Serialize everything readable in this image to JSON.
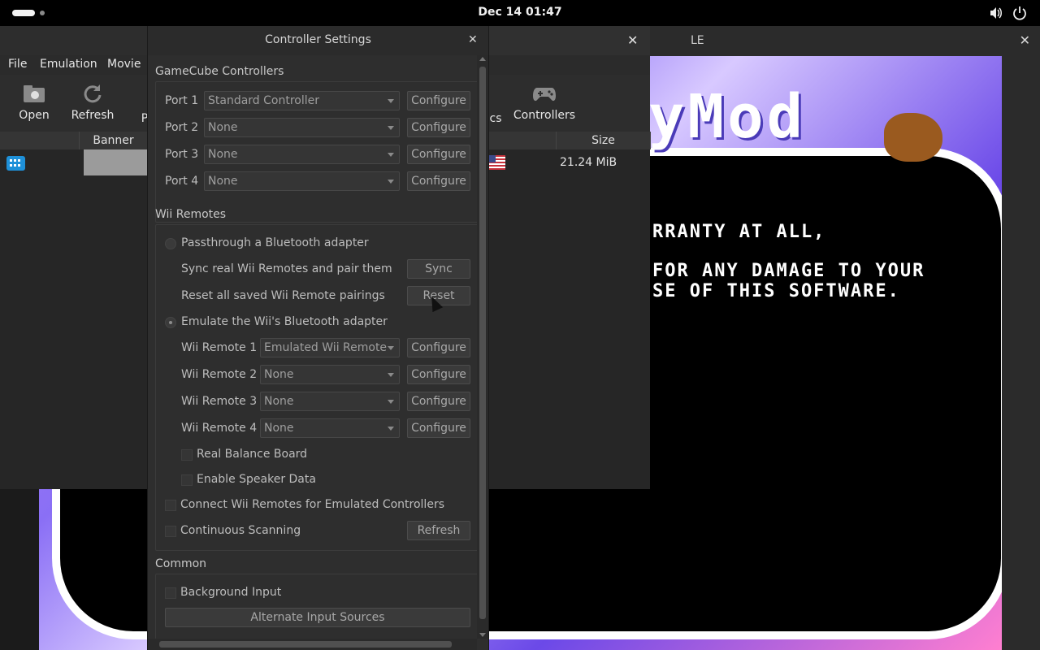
{
  "topbar": {
    "clock": "Dec 14  01:47",
    "icons": [
      "volume-icon",
      "power-icon"
    ]
  },
  "game_window": {
    "title_partial": "LE",
    "screen_text": [
      "yMod",
      "RRANTY AT ALL,",
      "FOR ANY DAMAGE TO YOUR",
      "SE OF THIS SOFTWARE."
    ]
  },
  "main_window": {
    "menu": [
      "File",
      "Emulation",
      "Movie"
    ],
    "toolbar": {
      "open": "Open",
      "refresh": "Refresh",
      "partial_left": "P",
      "partial_right": "cs",
      "controllers": "Controllers"
    },
    "columns": {
      "banner": "Banner",
      "size": "Size"
    },
    "row": {
      "size": "21.24 MiB"
    }
  },
  "dialog": {
    "title": "Controller Settings",
    "gamecube": {
      "heading": "GameCube Controllers",
      "ports": [
        {
          "label": "Port 1",
          "value": "Standard Controller"
        },
        {
          "label": "Port 2",
          "value": "None"
        },
        {
          "label": "Port 3",
          "value": "None"
        },
        {
          "label": "Port 4",
          "value": "None"
        }
      ]
    },
    "configure": "Configure",
    "wii": {
      "heading": "Wii Remotes",
      "passthrough": "Passthrough a Bluetooth adapter",
      "sync_text": "Sync real Wii Remotes and pair them",
      "sync_btn": "Sync",
      "reset_text": "Reset all saved Wii Remote pairings",
      "reset_btn": "Reset",
      "emulate": "Emulate the Wii's Bluetooth adapter",
      "remotes": [
        {
          "label": "Wii Remote 1",
          "value": "Emulated Wii Remote"
        },
        {
          "label": "Wii Remote 2",
          "value": "None"
        },
        {
          "label": "Wii Remote 3",
          "value": "None"
        },
        {
          "label": "Wii Remote 4",
          "value": "None"
        }
      ],
      "balance": "Real Balance Board",
      "speaker": "Enable Speaker Data",
      "connect": "Connect Wii Remotes for Emulated Controllers",
      "continuous": "Continuous Scanning",
      "refresh_btn": "Refresh"
    },
    "common": {
      "heading": "Common",
      "background": "Background Input",
      "alternate": "Alternate Input Sources"
    }
  }
}
